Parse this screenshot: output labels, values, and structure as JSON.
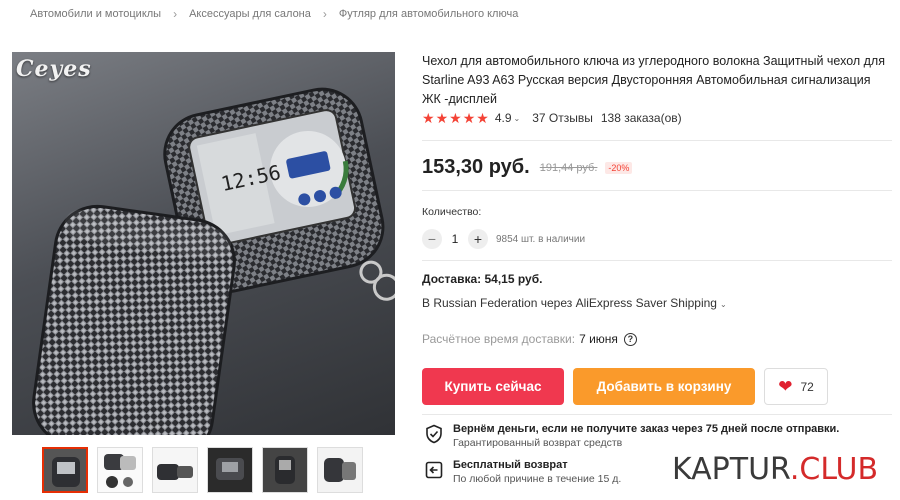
{
  "breadcrumb": {
    "items": [
      "Автомобили и мотоциклы",
      "Аксессуары для салона",
      "Футляр для автомобильного ключа"
    ],
    "separator": "›"
  },
  "product": {
    "brand_logo": "Ceyes",
    "title": "Чехол для автомобильного ключа из углеродного волокна Защитный чехол для Starline A93 A63 Русская версия Двусторонняя Автомобильная сигнализация ЖК -дисплей",
    "rating": "4.9",
    "stars": 5,
    "reviews": "37 Отзывы",
    "orders": "138 заказа(ов)",
    "price": "153,30 руб.",
    "old_price": "191,44 руб.",
    "discount": "-20%",
    "remote_screen_time": "12:56"
  },
  "quantity": {
    "label": "Количество:",
    "value": "1",
    "minus": "−",
    "plus": "+",
    "stock": "9854 шт. в наличии"
  },
  "delivery": {
    "title": "Доставка: 54,15 руб.",
    "method": "В Russian Federation через AliExpress Saver Shipping",
    "time_label": "Расчётное время доставки:",
    "time_value": "7 июня",
    "help": "?"
  },
  "actions": {
    "buy": "Купить сейчас",
    "cart": "Добавить в корзину",
    "wishlist_count": "72"
  },
  "guarantees": [
    {
      "title": "Вернём деньги, если не получите заказ через 75 дней после отправки.",
      "subtitle": "Гарантированный возврат средств",
      "icon": "shield-check-icon"
    },
    {
      "title": "Бесплатный возврат",
      "subtitle": "По любой причине в течение 15 д.",
      "icon": "return-box-icon"
    }
  ],
  "watermark": {
    "part1": "KAPTUR",
    "dot": ".",
    "part2": "CLUB"
  },
  "colors": {
    "accent_red": "#f0384f",
    "accent_orange": "#fa9a2b",
    "star": "#f44336"
  }
}
